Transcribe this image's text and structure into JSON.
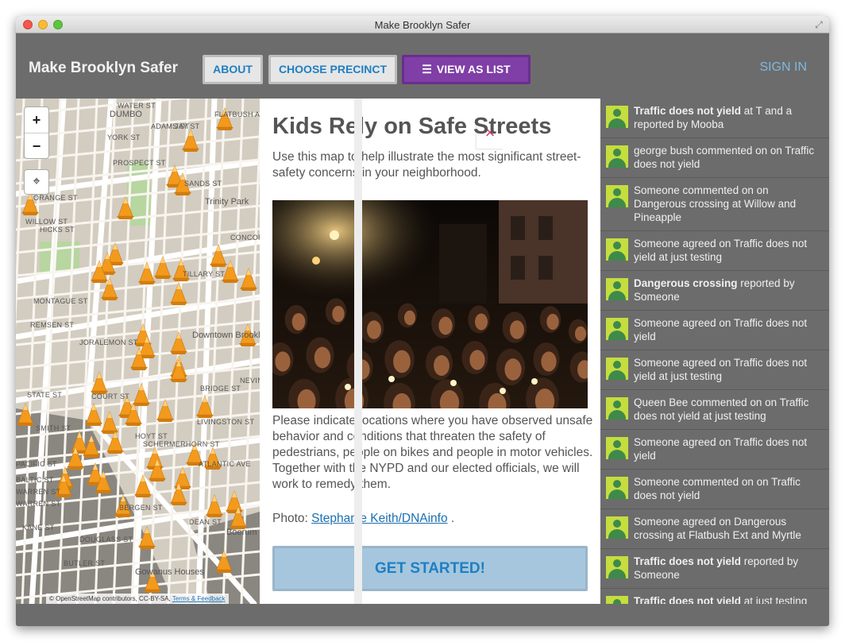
{
  "window": {
    "title": "Make Brooklyn Safer"
  },
  "header": {
    "app_title": "Make Brooklyn Safer",
    "about_label": "ABOUT",
    "choose_precinct_label": "CHOOSE PRECINCT",
    "view_as_list_label": "VIEW AS LIST",
    "sign_in_label": "SIGN IN"
  },
  "map": {
    "zoom_in": "+",
    "zoom_out": "−",
    "attribution_text": "© OpenStreetMap contributors, CC-BY-SA,",
    "attribution_link": "Terms & Feedback",
    "labels": [
      "WATER ST",
      "DUMBO",
      "YORK ST",
      "PROSPECT ST",
      "SANDS ST",
      "Trinity Park",
      "ORANGE ST",
      "HICKS ST",
      "WILLOW ST",
      "CONCORD ST",
      "TILLARY ST",
      "MONTAGUE ST",
      "REMSEN ST",
      "JORALEMON ST",
      "Downtown Brooklyn",
      "STATE ST",
      "COURT ST",
      "BRIDGE ST",
      "LIVINGSTON ST",
      "SCHERMERHORN ST",
      "ATLANTIC AVE",
      "DEAN ST",
      "Boerum Hill",
      "WARREN ST",
      "KANE ST",
      "BUTLER ST",
      "DOUGLASS ST",
      "Gowanus Houses",
      "SMITH ST",
      "NEVINS ST",
      "ADAMS ST",
      "JAY ST",
      "PACIFIC ST",
      "BALTIC ST",
      "WARREN ST",
      "HOYT ST",
      "BERGEN ST",
      "FLATBUSH AVE EXT"
    ]
  },
  "panel": {
    "close_label": "×",
    "title": "Kids Rely on Safe Streets",
    "intro": "Use this map to help illustrate the most significant street-safety concerns in your neighborhood.",
    "body": "Please indicate locations where you have observed unsafe behavior and conditions that threaten the safety of pedestrians, people on bikes and people in motor vehicles. Together with the NYPD and our elected officials, we will work to remedy them.",
    "photo_prefix": "Photo:",
    "photo_credit": "Stephanie Keith/DNAinfo",
    "photo_suffix": ".",
    "cta_label": "GET STARTED!"
  },
  "feed": {
    "items": [
      {
        "bold": "Traffic does not yield",
        "text": " at T and a reported by Mooba"
      },
      {
        "bold": "",
        "text": "george bush commented on on Traffic does not yield"
      },
      {
        "bold": "",
        "text": "Someone commented on on Dangerous crossing at Willow and Pineapple"
      },
      {
        "bold": "",
        "text": "Someone agreed on Traffic does not yield at just testing"
      },
      {
        "bold": "Dangerous crossing",
        "text": " reported by Someone"
      },
      {
        "bold": "",
        "text": "Someone agreed on Traffic does not yield"
      },
      {
        "bold": "",
        "text": "Someone agreed on Traffic does not yield at just testing"
      },
      {
        "bold": "",
        "text": "Queen Bee commented on on Traffic does not yield at just testing"
      },
      {
        "bold": "",
        "text": "Someone agreed on Traffic does not yield"
      },
      {
        "bold": "",
        "text": "Someone commented on on Traffic does not yield"
      },
      {
        "bold": "",
        "text": "Someone agreed on Dangerous crossing at Flatbush Ext and Myrtle"
      },
      {
        "bold": "Traffic does not yield",
        "text": " reported by Someone"
      },
      {
        "bold": "Traffic does not yield",
        "text": " at just testing reported by kamal"
      }
    ]
  },
  "colors": {
    "chrome": "#6c6c6c",
    "accent_blue": "#1f7fc2",
    "accent_purple": "#7f3fa6",
    "close_pink": "#d53c6a",
    "cone_orange": "#f39a1c",
    "avatar_green": "#c5dd3e"
  }
}
